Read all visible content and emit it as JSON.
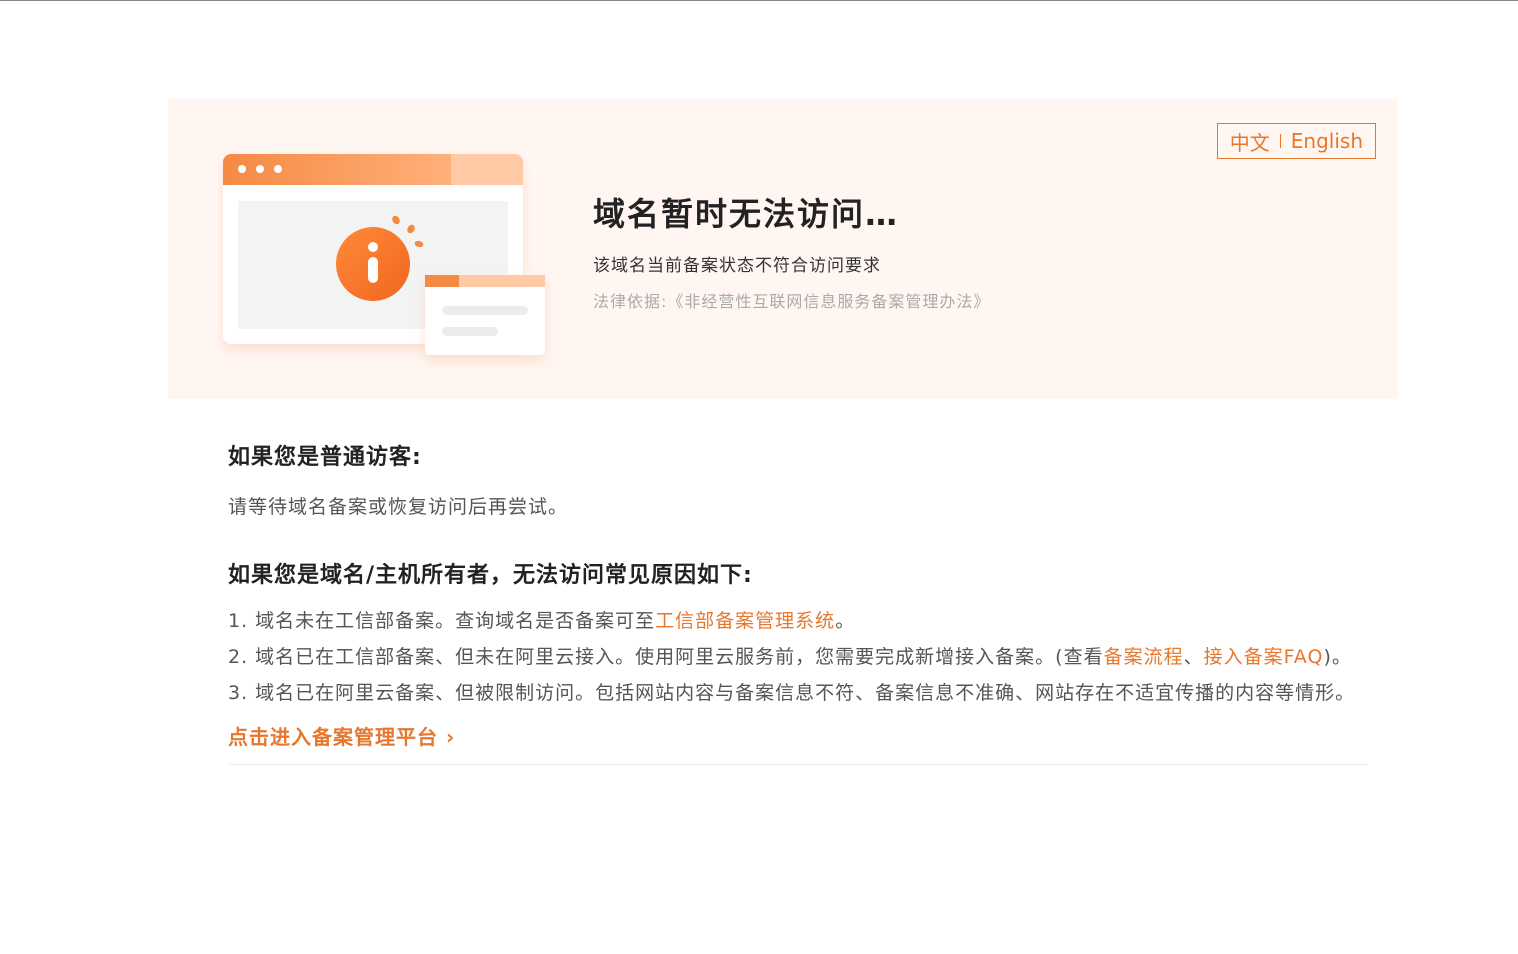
{
  "lang": {
    "zh": "中文",
    "en": "English"
  },
  "banner": {
    "title": "域名暂时无法访问…",
    "subtitle": "该域名当前备案状态不符合访问要求",
    "law": "法律依据:《非经营性互联网信息服务备案管理办法》"
  },
  "visitor": {
    "heading": "如果您是普通访客:",
    "text": "请等待域名备案或恢复访问后再尝试。"
  },
  "owner": {
    "heading": "如果您是域名/主机所有者，无法访问常见原因如下:",
    "item1_prefix": "1. 域名未在工信部备案。查询域名是否备案可至",
    "item1_link": "工信部备案管理系统",
    "item1_suffix": "。",
    "item2_prefix": "2. 域名已在工信部备案、但未在阿里云接入。使用阿里云服务前，您需要完成新增接入备案。(查看",
    "item2_link1": "备案流程",
    "item2_sep": "、",
    "item2_link2": "接入备案FAQ",
    "item2_suffix": ")。",
    "item3": "3. 域名已在阿里云备案、但被限制访问。包括网站内容与备案信息不符、备案信息不准确、网站存在不适宜传播的内容等情形。"
  },
  "cta": {
    "label": "点击进入备案管理平台",
    "arrow": "›"
  },
  "colors": {
    "accent": "#e8772e",
    "banner_bg": "#fff6f2"
  },
  "icons": {
    "illustration": "browser-info-icon"
  }
}
